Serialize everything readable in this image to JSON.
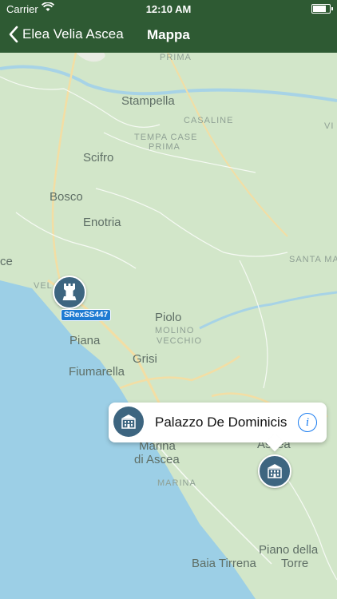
{
  "status_bar": {
    "carrier": "Carrier",
    "time": "12:10 AM",
    "battery_level": 0.9
  },
  "nav": {
    "back_label": "Elea Velia Ascea",
    "title": "Mappa"
  },
  "map": {
    "places": [
      {
        "name": "PRIMA",
        "kind": "small"
      },
      {
        "name": "Stampella",
        "kind": "town"
      },
      {
        "name": "CASALINE",
        "kind": "small"
      },
      {
        "name": "TEMPA CASE",
        "kind": "small"
      },
      {
        "name": "PRIMA",
        "kind": "small"
      },
      {
        "name": "Scifro",
        "kind": "town"
      },
      {
        "name": "Bosco",
        "kind": "town"
      },
      {
        "name": "Enotria",
        "kind": "town"
      },
      {
        "name": "SANTA MA",
        "kind": "small"
      },
      {
        "name": "VEL",
        "kind": "small"
      },
      {
        "name": "ce",
        "kind": "town"
      },
      {
        "name": "Piolo",
        "kind": "town"
      },
      {
        "name": "MOLINO",
        "kind": "small"
      },
      {
        "name": "VECCHIO",
        "kind": "small"
      },
      {
        "name": "Piana",
        "kind": "town"
      },
      {
        "name": "Grisi",
        "kind": "town"
      },
      {
        "name": "Fiumarella",
        "kind": "town"
      },
      {
        "name": "Marina",
        "kind": "town"
      },
      {
        "name": "di Ascea",
        "kind": "town"
      },
      {
        "name": "MARINA",
        "kind": "small"
      },
      {
        "name": "Ascea",
        "kind": "town"
      },
      {
        "name": "Piano della",
        "kind": "town"
      },
      {
        "name": "Baia Tirrena",
        "kind": "town"
      },
      {
        "name": "Torre",
        "kind": "town"
      },
      {
        "name": "VI",
        "kind": "small"
      }
    ],
    "road_badge": "SRexSS447",
    "callout": {
      "title": "Palazzo De Dominicis",
      "info_glyph": "i"
    }
  }
}
